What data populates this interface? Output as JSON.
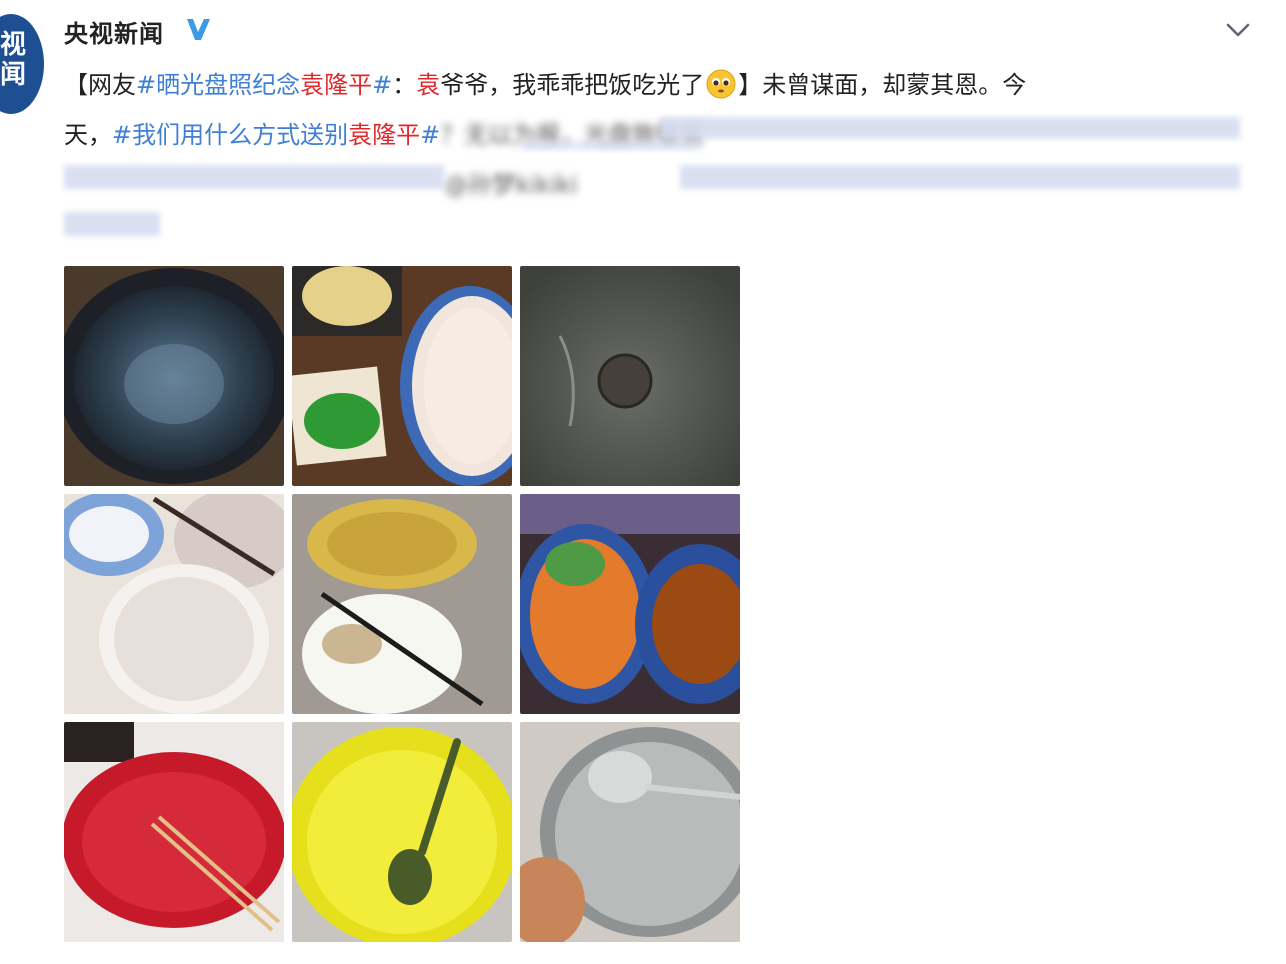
{
  "account": {
    "avatar_chars": [
      "视",
      "闻"
    ],
    "name": "央视新闻",
    "verified_icon": "verified-badge-icon",
    "menu_icon": "chevron-down-icon"
  },
  "post": {
    "line1": {
      "open_bracket": "【网友",
      "tag1": "#晒光盘照纪念",
      "tag1_name": "袁隆平",
      "tag1_end": "#",
      "colon": "：",
      "name": "袁",
      "text_after": "爷爷，我乖乖把饭吃光了",
      "emoji_icon": "pleading-face-emoji-icon",
      "close_text": "】未曾谋面，却蒙其恩。今"
    },
    "line2": {
      "start": "天，",
      "tag2": "#我们用什么方式送别",
      "tag2_name": "袁隆平",
      "tag2_end": "#",
      "text_after": "？无以为报，光盘致敬",
      "name": "袁"
    },
    "line3": {
      "mention": "@孙梦kikiki"
    }
  },
  "colors": {
    "link": "#3f7fd5",
    "highlight": "#e2272c",
    "avatar_bg": "#1f4f93",
    "verified": "#3d9ae8"
  },
  "photos": [
    {
      "name": "photo-dark-metal-bowl"
    },
    {
      "name": "photo-seaweed-and-patterned-plate"
    },
    {
      "name": "photo-grey-bowl-with-emblem"
    },
    {
      "name": "photo-blue-floral-bowls-and-white-plate"
    },
    {
      "name": "photo-glass-bowl-and-white-plate-with-chopsticks"
    },
    {
      "name": "photo-salad-and-patterned-plate"
    },
    {
      "name": "photo-red-bowl-with-chopsticks"
    },
    {
      "name": "photo-yellow-bowl-with-spoon"
    },
    {
      "name": "photo-steel-pot-with-ladle"
    }
  ]
}
